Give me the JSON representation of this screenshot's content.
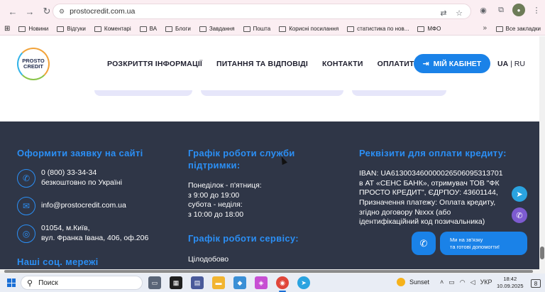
{
  "browser": {
    "url": "prostocredit.com.ua",
    "bookmarks": [
      "Новини",
      "Відгуки",
      "Коментарі",
      "ВА",
      "Блоги",
      "Завдання",
      "Пошта",
      "Корисні посилання",
      "статистика по нов...",
      "МФО"
    ],
    "bookmarks_more": "»",
    "all_bookmarks": "Все закладки"
  },
  "header": {
    "logo_line1": "PROSTO",
    "logo_line2": "CREDIT",
    "menu": [
      "РОЗКРИТТЯ ІНФОРМАЦІЇ",
      "ПИТАННЯ ТА ВІДПОВІДІ",
      "КОНТАКТИ",
      "ОПЛАТИТИ"
    ],
    "cabinet_label": "МІЙ КАБІНЕТ",
    "lang_active": "UA",
    "lang_sep": " | ",
    "lang_other": "RU"
  },
  "footer": {
    "apply_title": "Оформити заявку на сайті",
    "phone": "0 (800) 33-34-34",
    "phone_note": "безкоштовно по Україні",
    "email": "info@prostocredit.com.ua",
    "address_line1": "01054, м.Київ,",
    "address_line2": "вул. Франка Івана, 406, оф.206",
    "social_title": "Наші соц. мережі",
    "support_title_line1": "Графік роботи служби",
    "support_title_line2": "підтримки:",
    "support_schedule": [
      "Понеділок - п'ятниця:",
      "з 9:00 до 19:00",
      "субота - неділя:",
      "з 10:00 до 18:00"
    ],
    "service_title": "Графік роботи сервісу:",
    "service_hours": "Цілодобово",
    "details_title": "Реквізити для оплати кредиту:",
    "details_text": [
      "IBAN: UA613003460000026506095313701",
      "в АТ «СЕНС БАНК», отримувач ТОВ \"ФК",
      "ПРОСТО КРЕДИТ\", ЄДРПОУ: 43601144,",
      "Призначення платежу: Оплата кредиту,",
      "згідно договору №ххх (або",
      "ідентифікаційний код позичальника)"
    ],
    "help_line1": "Ми на зв'язку",
    "help_line2": "та готові допомогти!"
  },
  "taskbar": {
    "search_label": "Поиск",
    "weather": "Sunset",
    "lang": "УКР",
    "time": "18:42",
    "date": "10.09.2025",
    "notifications": "8"
  },
  "colors": {
    "accent": "#1a82e8",
    "footer_bg": "#2f3647",
    "footer_title": "#2b8ff5"
  }
}
